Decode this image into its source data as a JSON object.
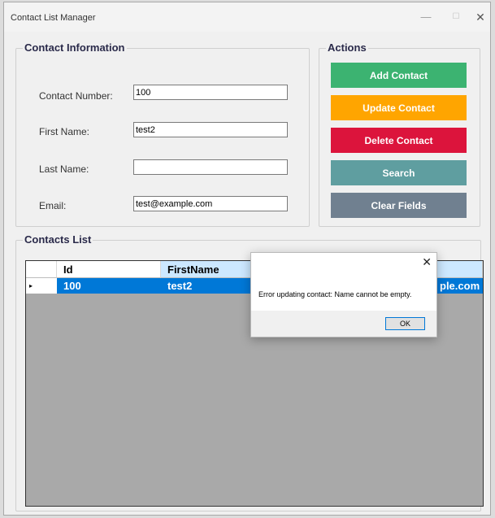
{
  "window": {
    "title": "Contact List Manager",
    "controls": {
      "minimize": "—",
      "maximize": "☐",
      "close": "✕"
    }
  },
  "contact_info": {
    "legend": "Contact Information",
    "fields": {
      "contact_number": {
        "label": "Contact Number:",
        "value": "100"
      },
      "first_name": {
        "label": "First Name:",
        "value": "test2"
      },
      "last_name": {
        "label": "Last Name:",
        "value": ""
      },
      "email": {
        "label": "Email:",
        "value": "test@example.com"
      }
    }
  },
  "actions": {
    "legend": "Actions",
    "buttons": [
      {
        "label": "Add Contact",
        "color": "#3cb371"
      },
      {
        "label": "Update Contact",
        "color": "#ffa500"
      },
      {
        "label": "Delete Contact",
        "color": "#dc143c"
      },
      {
        "label": "Search",
        "color": "#5f9ea0"
      },
      {
        "label": "Clear Fields",
        "color": "#708090"
      }
    ]
  },
  "contacts_list": {
    "legend": "Contacts List",
    "columns": [
      "Id",
      "FirstName"
    ],
    "selected_row": {
      "marker": "▸",
      "id": "100",
      "first_name": "test2",
      "email_partial": "ple.com"
    },
    "selection_color": "#0078d7"
  },
  "dialog": {
    "message": "Error updating contact: Name cannot be empty.",
    "ok_label": "OK",
    "close": "✕"
  }
}
